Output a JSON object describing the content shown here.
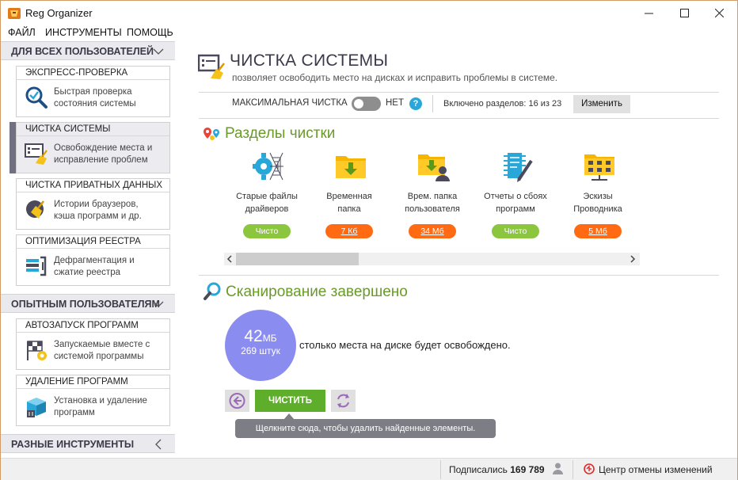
{
  "window": {
    "title": "Reg Organizer"
  },
  "menu": [
    "ФАЙЛ",
    "ИНСТРУМЕНТЫ",
    "ПОМОЩЬ"
  ],
  "sidebar": {
    "groups": [
      {
        "label": "ДЛЯ ВСЕХ ПОЛЬЗОВАТЕЛЕЙ"
      },
      {
        "label": "ОПЫТНЫМ ПОЛЬЗОВАТЕЛЯМ"
      },
      {
        "label": "РАЗНЫЕ ИНСТРУМЕНТЫ"
      }
    ],
    "items": [
      {
        "title": "ЭКСПРЕСС-ПРОВЕРКА",
        "desc1": "Быстрая проверка",
        "desc2": "состояния системы",
        "icon": "magnifier-check-icon"
      },
      {
        "title": "ЧИСТКА СИСТЕМЫ",
        "desc1": "Освобождение места и",
        "desc2": "исправление проблем",
        "icon": "system-cleanup-icon"
      },
      {
        "title": "ЧИСТКА ПРИВАТНЫХ ДАННЫХ",
        "desc1": "Истории браузеров,",
        "desc2": "кэша программ и др.",
        "icon": "privacy-broom-icon"
      },
      {
        "title": "ОПТИМИЗАЦИЯ РЕЕСТРА",
        "desc1": "Дефрагментация и",
        "desc2": "сжатие реестра",
        "icon": "registry-compress-icon"
      },
      {
        "title": "АВТОЗАПУСК ПРОГРАММ",
        "desc1": "Запускаемые вместе с",
        "desc2": "системой программы",
        "icon": "autostart-flag-icon"
      },
      {
        "title": "УДАЛЕНИЕ ПРОГРАММ",
        "desc1": "Установка и удаление",
        "desc2": "программ",
        "icon": "uninstall-box-icon"
      }
    ]
  },
  "main": {
    "title": "ЧИСТКА СИСТЕМЫ",
    "subtitle": "позволяет освободить место на дисках и исправить проблемы в системе.",
    "options": {
      "max_clean_label": "МАКСИМАЛЬНАЯ ЧИСТКА",
      "toggle_state": "НЕТ",
      "help": "?",
      "sections_label": "Включено разделов: 16 из 23",
      "change_button": "Изменить"
    },
    "sections_title": "Разделы чистки",
    "categories": [
      {
        "line1": "Старые файлы",
        "line2": "драйверов",
        "badge": "Чисто",
        "status": "clean",
        "icon": "gear-web-icon"
      },
      {
        "line1": "Временная",
        "line2": "папка",
        "badge": "7 Кб",
        "status": "found",
        "icon": "temp-folder-icon"
      },
      {
        "line1": "Врем. папка",
        "line2": "пользователя",
        "badge": "34 Мб",
        "status": "found",
        "icon": "user-folder-icon"
      },
      {
        "line1": "Отчеты о сбоях",
        "line2": "программ",
        "badge": "Чисто",
        "status": "clean",
        "icon": "crash-report-icon"
      },
      {
        "line1": "Эскизы",
        "line2": "Проводника",
        "badge": "5 Мб",
        "status": "found",
        "icon": "thumbnails-folder-icon"
      }
    ],
    "scan": {
      "title": "Сканирование завершено",
      "size_value": "42",
      "size_unit": "МБ",
      "items_count": "269 штук",
      "result_text": "столько места на диске будет освобождено.",
      "clean_button": "ЧИСТИТЬ",
      "tooltip": "Щелкните сюда, чтобы удалить найденные элементы."
    }
  },
  "status": {
    "subscribers_label": "Подписались",
    "subscribers_count": "169 789",
    "undo_center": "Центр отмены изменений"
  },
  "colors": {
    "accent_green": "#6a9a2a",
    "clean_badge": "#8cc63f",
    "found_badge": "#ff6a13",
    "clean_button": "#5fae2b",
    "size_circle": "#8b8cf0",
    "help_icon": "#2aa7d9"
  }
}
